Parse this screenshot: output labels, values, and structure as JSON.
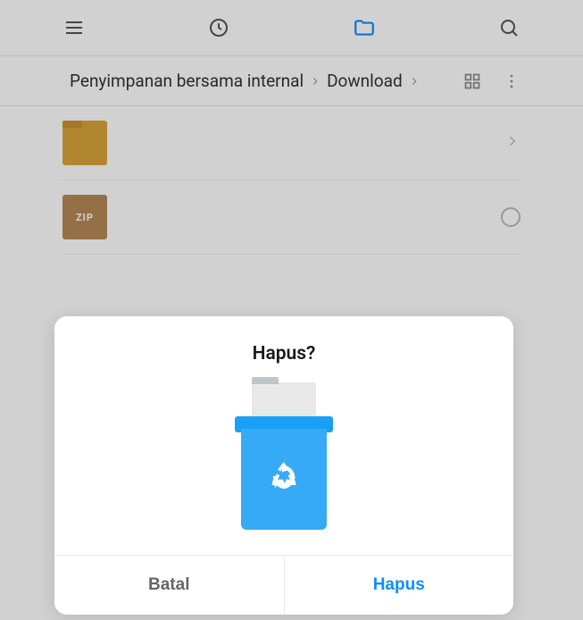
{
  "topbar": {
    "tabs": [
      "menu",
      "recent",
      "folder",
      "search"
    ],
    "active_tab": "folder"
  },
  "breadcrumb": {
    "parts": [
      "Penyimpanan bersama internal",
      "Download"
    ]
  },
  "files": {
    "folder_label": "",
    "zip_label": "ZIP"
  },
  "dialog": {
    "title": "Hapus?",
    "cancel_label": "Batal",
    "confirm_label": "Hapus"
  }
}
